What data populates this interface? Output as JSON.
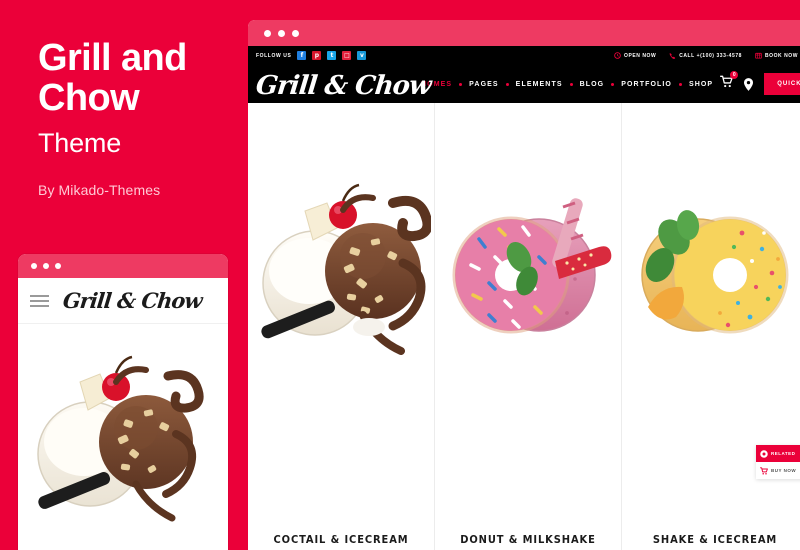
{
  "promo": {
    "title_line1": "Grill and",
    "title_line2": "Chow",
    "subtitle": "Theme",
    "byline": "By Mikado-Themes"
  },
  "colors": {
    "brand_red": "#eb0039",
    "titlebar_pink": "#ee3a62",
    "bar_black": "#000000",
    "text_dark": "#1b1b1b",
    "byline": "#ffc9d5"
  },
  "mobile_preview": {
    "logo": "Grill & Chow",
    "menu_icon": "hamburger-icon",
    "titlebar_dots": 3
  },
  "browser": {
    "titlebar_dots": 3,
    "topbar": {
      "follow_label": "Follow Us",
      "social": [
        {
          "name": "facebook-icon",
          "glyph": "f",
          "color": "#1f7fe0"
        },
        {
          "name": "pinterest-icon",
          "glyph": "p",
          "color": "#d5152b"
        },
        {
          "name": "twitter-icon",
          "glyph": "t",
          "color": "#18a5e8"
        },
        {
          "name": "instagram-icon",
          "glyph": "in",
          "color": "#e0213c"
        },
        {
          "name": "vimeo-icon",
          "glyph": "v",
          "color": "#1799d8"
        }
      ],
      "info": [
        {
          "icon": "clock-icon",
          "label": "Open Now"
        },
        {
          "icon": "phone-icon",
          "label": "Call +(100) 333-4578"
        },
        {
          "icon": "calendar-icon",
          "label": "Book Now"
        }
      ]
    },
    "nav": {
      "logo": "Grill & Chow",
      "items": [
        {
          "label": "Homes",
          "active": true
        },
        {
          "label": "Pages",
          "active": false
        },
        {
          "label": "Elements",
          "active": false
        },
        {
          "label": "Blog",
          "active": false
        },
        {
          "label": "Portfolio",
          "active": false
        },
        {
          "label": "Shop",
          "active": false
        }
      ],
      "cart_icon": "cart-icon",
      "cart_count": "0",
      "location_icon": "map-pin-icon",
      "quick_order_label": "Quick Order"
    },
    "products": [
      {
        "title": "Coctail & Icecream",
        "image": "milkshake-and-chocolate-icecream"
      },
      {
        "title": "Donut & Milkshake",
        "image": "pink-donut-and-strawberry-smoothie"
      },
      {
        "title": "Shake & Icecream",
        "image": "mango-shake-and-yellow-donut"
      }
    ],
    "side_widget": {
      "related_icon": "circle-dot-icon",
      "related_label": "Related",
      "buy_icon": "cart-icon",
      "buy_label": "Buy Now"
    }
  }
}
